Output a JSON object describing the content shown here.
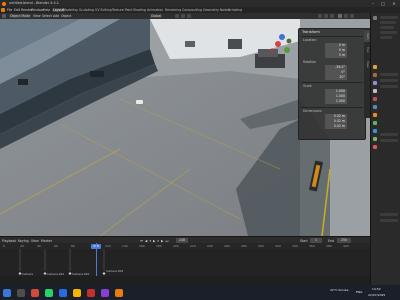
{
  "titlebar": {
    "title": "untitled.blend - Blender 4.4.1"
  },
  "menu": {
    "items": [
      "File",
      "Edit",
      "Render",
      "Window",
      "Help"
    ],
    "workspaces": [
      "Layout",
      "Modeling",
      "Sculpting",
      "UV Editing",
      "Texture Paint",
      "Shading",
      "Animation",
      "Rendering",
      "Compositing",
      "Geometry Nodes",
      "Scripting"
    ],
    "active_workspace": "Layout"
  },
  "header": {
    "mode": "Object Mode",
    "view": "View",
    "select": "Select",
    "add": "Add",
    "object": "Object",
    "orientation": "Global"
  },
  "npanel": {
    "section_transform": "Transform",
    "location": {
      "label": "Location",
      "x": "0 m",
      "y": "0 m",
      "z": "5 m"
    },
    "rotation": {
      "label": "Rotation",
      "x": "-36.4°",
      "y": "0°",
      "z": "20°"
    },
    "scale": {
      "label": "Scale",
      "x": "1.000",
      "y": "1.000",
      "z": "1.000"
    },
    "dimensions": {
      "label": "Dimensions",
      "x": "0.02 m",
      "y": "0.02 m",
      "z": "0.02 m"
    },
    "tabs": [
      "Item",
      "Tool",
      "View"
    ]
  },
  "timeline": {
    "controls": {
      "playback": "Playback",
      "keying": "Keying",
      "view": "View",
      "marker": "Marker"
    },
    "current_frame": "248",
    "start_label": "Start",
    "start": "1",
    "end_label": "End",
    "end": "250",
    "ticks": [
      "0",
      "20",
      "40",
      "60",
      "80",
      "100",
      "120",
      "140",
      "160",
      "180",
      "200",
      "220",
      "240",
      "260",
      "280",
      "300",
      "320",
      "340",
      "360",
      "380",
      "400"
    ],
    "channels": [
      "Camera",
      "Camera.001",
      "Camera.002",
      "Camera.003",
      "Camera.004"
    ]
  },
  "taskbar": {
    "lang": "ENG",
    "time": "14:52",
    "date": "22/07/2025",
    "weather": "22°C Smoke"
  },
  "colors": {
    "accent": "#4b7bd5",
    "blender_orange": "#e87d0d"
  }
}
